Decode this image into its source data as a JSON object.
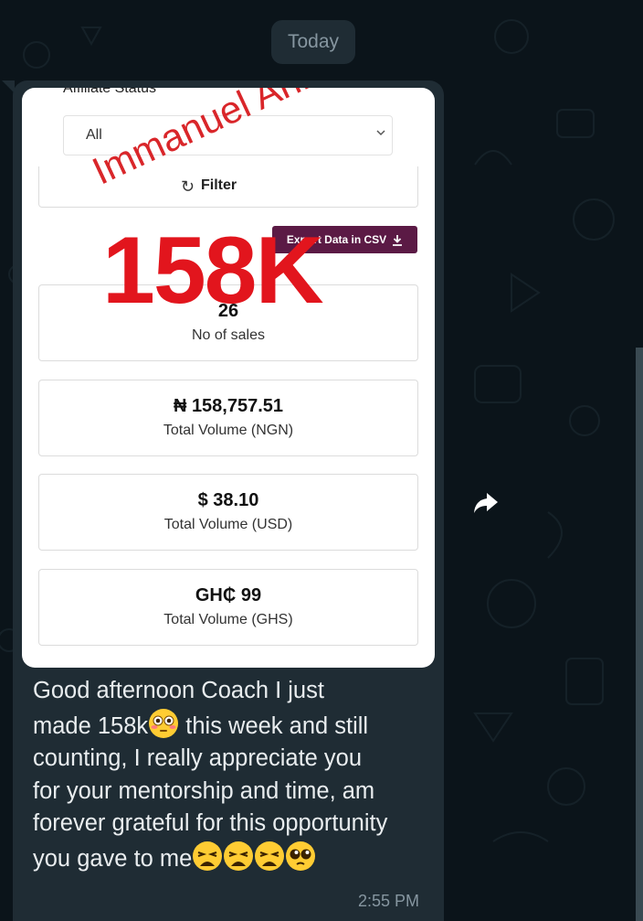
{
  "date_chip": "Today",
  "screenshot": {
    "affiliate_status_label": "Affiliate Status",
    "select_value": "All",
    "filter_label": "Filter",
    "export_label": "Export Data in CSV",
    "watermark_name": "Immanuel Ani",
    "watermark_amount": "158K",
    "stats": [
      {
        "value": "26",
        "label": "No of sales"
      },
      {
        "value": "₦ 158,757.51",
        "label": "Total Volume (NGN)"
      },
      {
        "value": "$ 38.10",
        "label": "Total Volume (USD)"
      },
      {
        "value": "GH₵ 99",
        "label": "Total Volume (GHS)"
      }
    ]
  },
  "message": {
    "line1": "Good afternoon Coach I just",
    "line2_a": "made 158k",
    "line2_b": " this week and still",
    "line3": "counting, I really appreciate you",
    "line4": "for your mentorship and time, am",
    "line5": "forever grateful for this opportunity",
    "line6": "you gave to me",
    "time": "2:55 PM"
  },
  "icons": {
    "forward": "forward-arrow-icon",
    "flushed_emoji": "flushed-face-emoji",
    "weary_emoji": "weary-face-emoji",
    "pleading_emoji": "pleading-face-emoji"
  },
  "colors": {
    "chat_background": "#0b141a",
    "bubble": "#1f2c34",
    "export_button": "#5b1a45",
    "watermark_red": "#e2151d"
  }
}
